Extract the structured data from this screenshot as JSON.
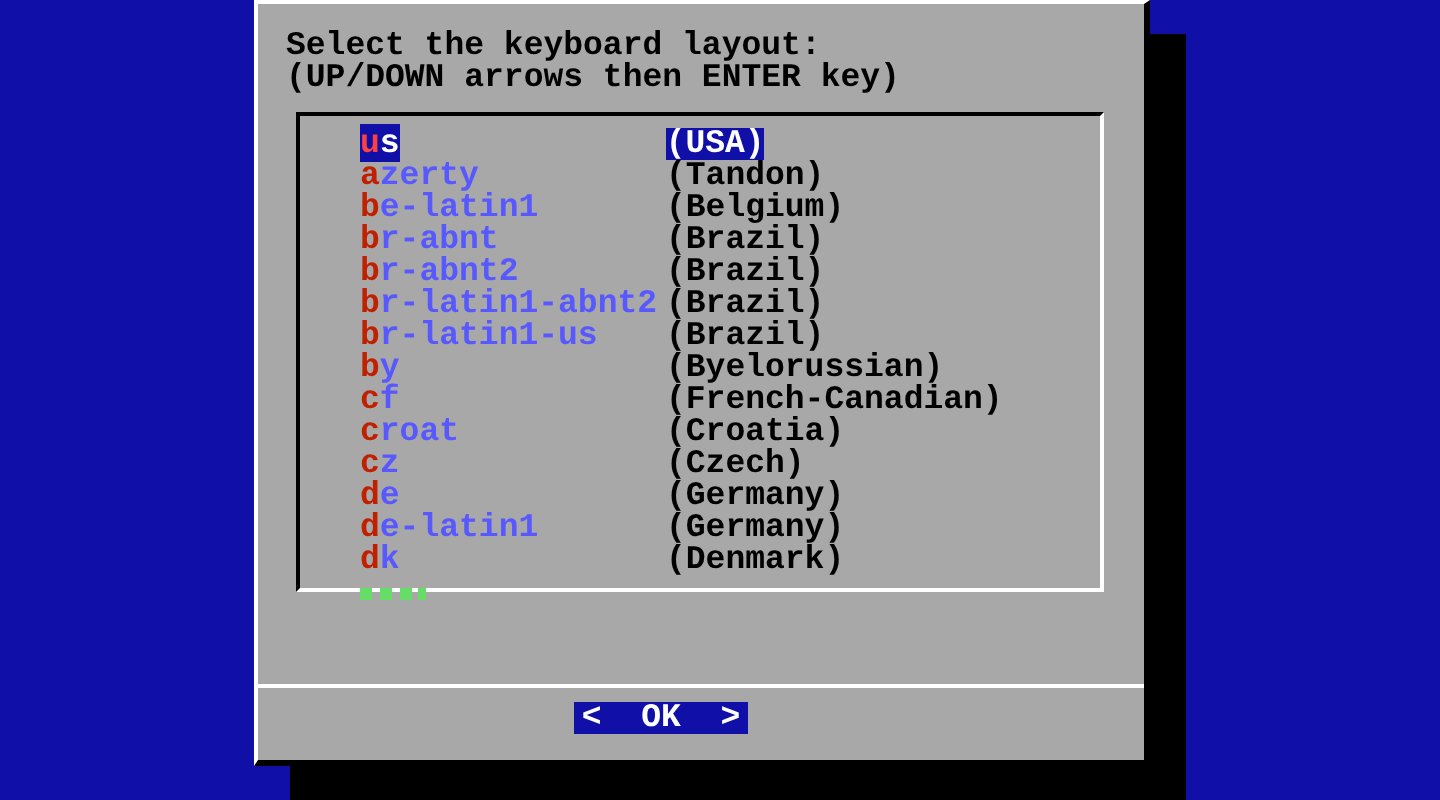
{
  "dialog": {
    "prompt": [
      "Select the keyboard layout:",
      "(UP/DOWN arrows then ENTER key)"
    ],
    "layouts": [
      {
        "key": "us",
        "description": "(USA)",
        "selected": true
      },
      {
        "key": "azerty",
        "description": "(Tandon)",
        "selected": false
      },
      {
        "key": "be-latin1",
        "description": "(Belgium)",
        "selected": false
      },
      {
        "key": "br-abnt",
        "description": "(Brazil)",
        "selected": false
      },
      {
        "key": "br-abnt2",
        "description": "(Brazil)",
        "selected": false
      },
      {
        "key": "br-latin1-abnt2",
        "description": "(Brazil)",
        "selected": false
      },
      {
        "key": "br-latin1-us",
        "description": "(Brazil)",
        "selected": false
      },
      {
        "key": "by",
        "description": "(Byelorussian)",
        "selected": false
      },
      {
        "key": "cf",
        "description": "(French-Canadian)",
        "selected": false
      },
      {
        "key": "croat",
        "description": "(Croatia)",
        "selected": false
      },
      {
        "key": "cz",
        "description": "(Czech)",
        "selected": false
      },
      {
        "key": "de",
        "description": "(Germany)",
        "selected": false
      },
      {
        "key": "de-latin1",
        "description": "(Germany)",
        "selected": false
      },
      {
        "key": "dk",
        "description": "(Denmark)",
        "selected": false
      }
    ],
    "buttons": [
      {
        "label": "<  OK  >",
        "selected": true
      }
    ]
  }
}
